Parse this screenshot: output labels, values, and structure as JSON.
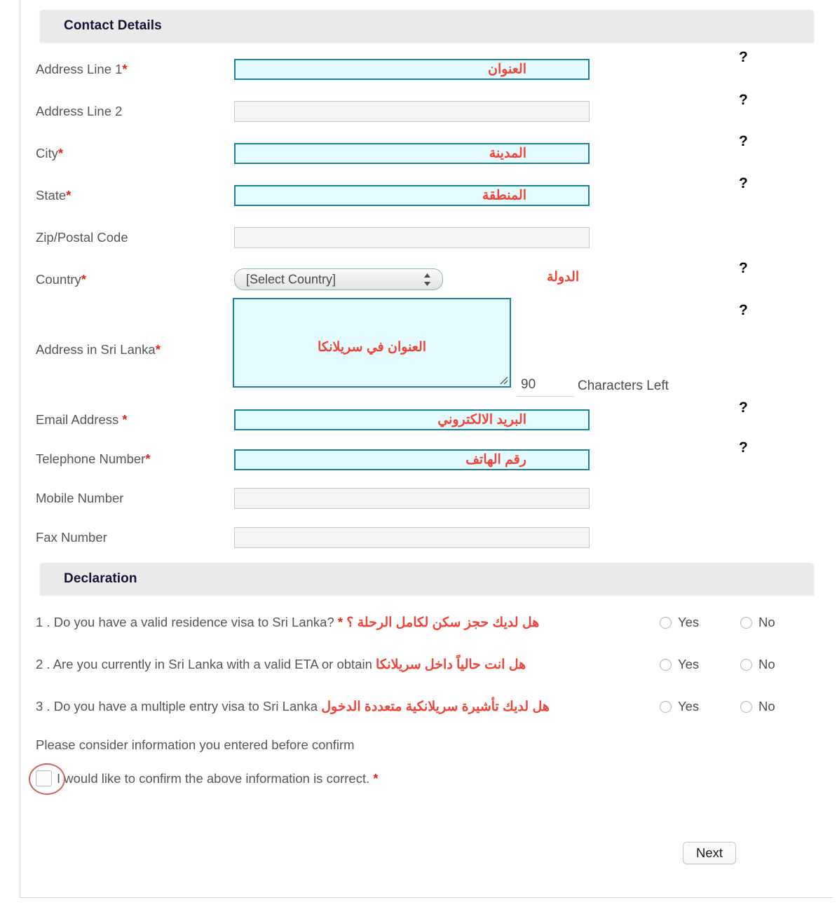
{
  "sections": {
    "contact": {
      "title": "Contact Details"
    },
    "declaration": {
      "title": "Declaration"
    }
  },
  "fields": [
    {
      "label": "Address Line 1",
      "required": true,
      "arabic": "العنوان",
      "help": "?"
    },
    {
      "label": "Address Line 2",
      "required": false,
      "arabic": "",
      "help": "?"
    },
    {
      "label": "City",
      "required": true,
      "arabic": "المدينة",
      "help": "?"
    },
    {
      "label": "State",
      "required": true,
      "arabic": "المنطقة",
      "help": "?"
    },
    {
      "label": "Zip/Postal Code",
      "required": false,
      "arabic": "",
      "help": ""
    },
    {
      "label": "Country",
      "required": true,
      "arabic": "الدولة",
      "help": "?"
    },
    {
      "label": "Address in Sri Lanka",
      "required": true,
      "arabic": "العنوان في سريلانكا",
      "help": "?"
    },
    {
      "label": "Email Address",
      "required": true,
      "arabic": "البريد الالكتروني",
      "help": "?"
    },
    {
      "label": "Telephone Number",
      "required": true,
      "arabic": "رقم الهاتف",
      "help": "?"
    },
    {
      "label": "Mobile Number",
      "required": false,
      "arabic": "",
      "help": ""
    },
    {
      "label": "Fax Number",
      "required": false,
      "arabic": "",
      "help": ""
    }
  ],
  "country_select": {
    "selected": "[Select Country]",
    "options": [
      "[Select Country]"
    ]
  },
  "sri_lanka_address": {
    "arabic": "العنوان في سريلانكا",
    "chars_left_value": "90",
    "chars_left_label": "Characters Left"
  },
  "required_marker": "*",
  "declaration": {
    "questions": [
      {
        "number": "1 .",
        "text": "Do you have a valid residence visa to Sri Lanka?",
        "marker": "*",
        "arabic": "هل لديك حجز سكن لكامل الرحلة ؟",
        "yes": "Yes",
        "no": "No"
      },
      {
        "number": "2 .",
        "text": "Are you currently in Sri Lanka with a valid ETA or obtain",
        "marker": "",
        "arabic": "هل انت حالياً داخل سريلانكا",
        "yes": "Yes",
        "no": "No"
      },
      {
        "number": "3 .",
        "text": "Do you have a multiple entry visa to Sri Lanka",
        "marker": "",
        "arabic": "هل لديك تأشيرة سريلانكية متعددة الدخول",
        "yes": "Yes",
        "no": "No"
      }
    ],
    "note": "Please consider information you entered before confirm",
    "confirm_text": "I would like to confirm the above information is correct.",
    "confirm_marker": "*"
  },
  "footer": {
    "next_label": "Next"
  },
  "colors": {
    "required_border": "#1f8099",
    "required_bg": "#e3fbff",
    "arabic_red": "#ef4437",
    "asterisk_red": "#e2231a",
    "header_bg": "#eaeaea",
    "header_text": "#131336",
    "annotation_red": "#d4625e"
  }
}
